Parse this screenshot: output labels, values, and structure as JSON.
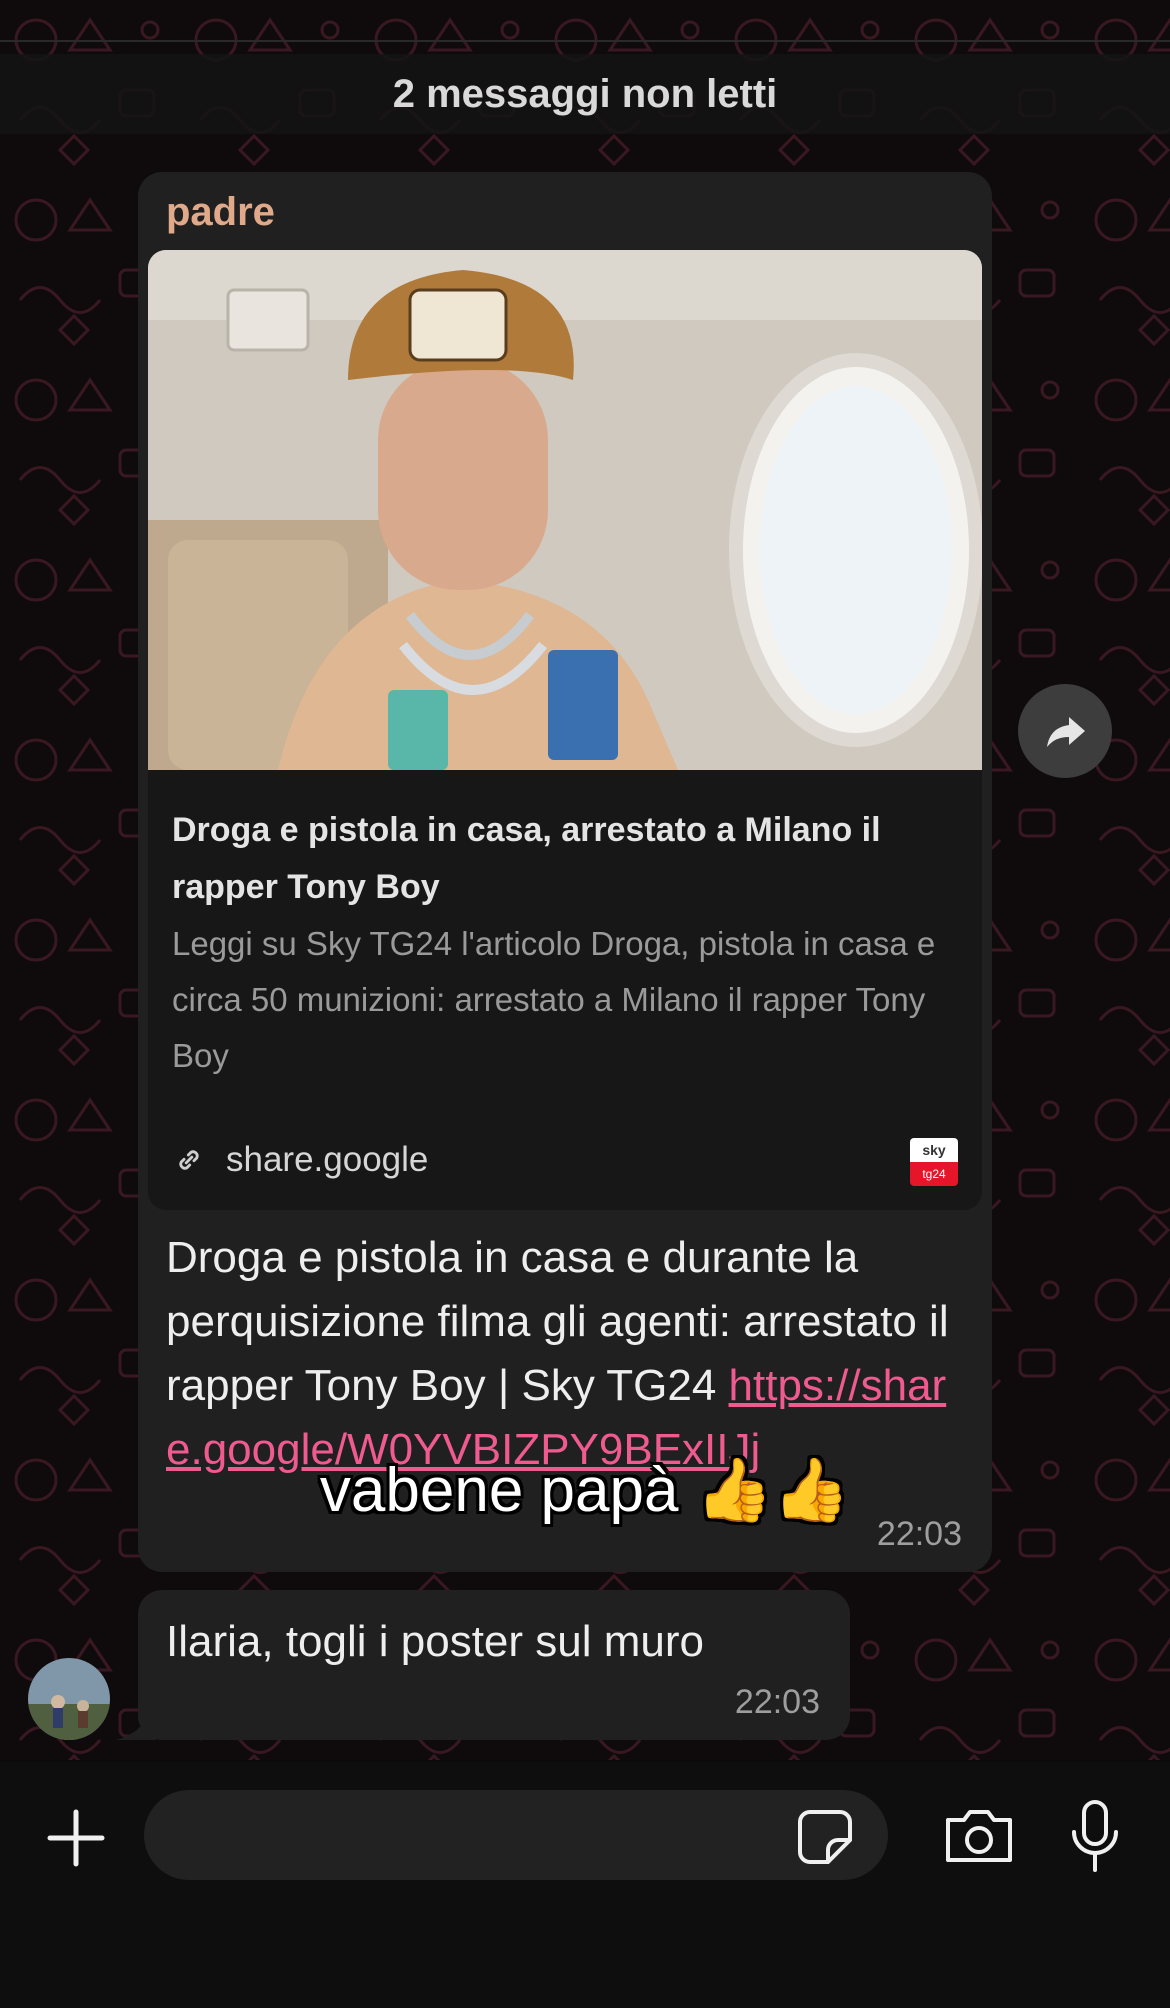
{
  "banner": {
    "unread_text": "2 messaggi non letti"
  },
  "message_main": {
    "sender": "padre",
    "preview": {
      "title": "Droga e pistola in casa, arrestato a Milano il rapper Tony Boy",
      "description": "Leggi su Sky TG24 l'articolo Droga, pistola in casa e circa 50 munizioni: arrestato a Milano il rapper Tony Boy",
      "domain": "share.google",
      "logo_top": "sky",
      "logo_bottom": "tg24"
    },
    "text": "Droga e pistola in casa e durante la perquisizione filma gli agenti: arrestato il rapper Tony Boy | Sky TG24 ",
    "link": "https://share.google/W0YVBIZPY9BExIIJj",
    "time": "22:03"
  },
  "message_second": {
    "text": "Ilaria, togli i poster sul muro",
    "time": "22:03"
  },
  "caption": "vabene papà 👍👍",
  "composer": {
    "placeholder": ""
  },
  "colors": {
    "sender": "#e0a98a",
    "link": "#ef5a8f",
    "bubble": "#202020",
    "background": "#0b0b0b"
  },
  "icons": [
    "forward-icon",
    "link-icon",
    "plus-icon",
    "sticker-icon",
    "camera-icon",
    "microphone-icon"
  ]
}
